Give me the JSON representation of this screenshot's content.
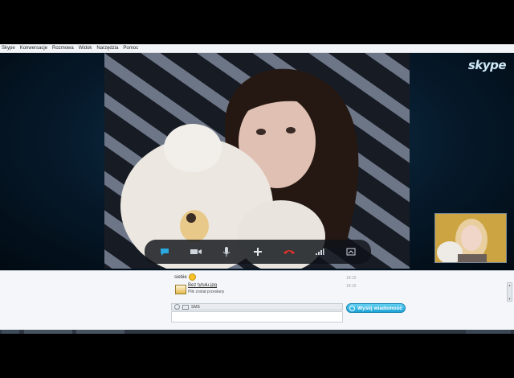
{
  "menu": {
    "items": [
      "Skype",
      "Konwersacje",
      "Rozmowa",
      "Widok",
      "Narzędzia",
      "Pomoc"
    ]
  },
  "logo_text": "skype",
  "chat": {
    "message1": "siebie",
    "message1_time": "18:15",
    "file_title": "Bez tytułu.jpg",
    "file_status": "Plik został przesłany",
    "file_time": "18:16"
  },
  "input": {
    "sms_label": "SMS",
    "value": ""
  },
  "send_button": {
    "label": "Wyślij wiadomość"
  },
  "icons": [
    "chat-icon",
    "video-icon",
    "microphone-icon",
    "plus-icon",
    "hangup-icon",
    "signal-icon",
    "fullscreen-icon",
    "smiley-icon",
    "sms-icon",
    "send-icon"
  ]
}
